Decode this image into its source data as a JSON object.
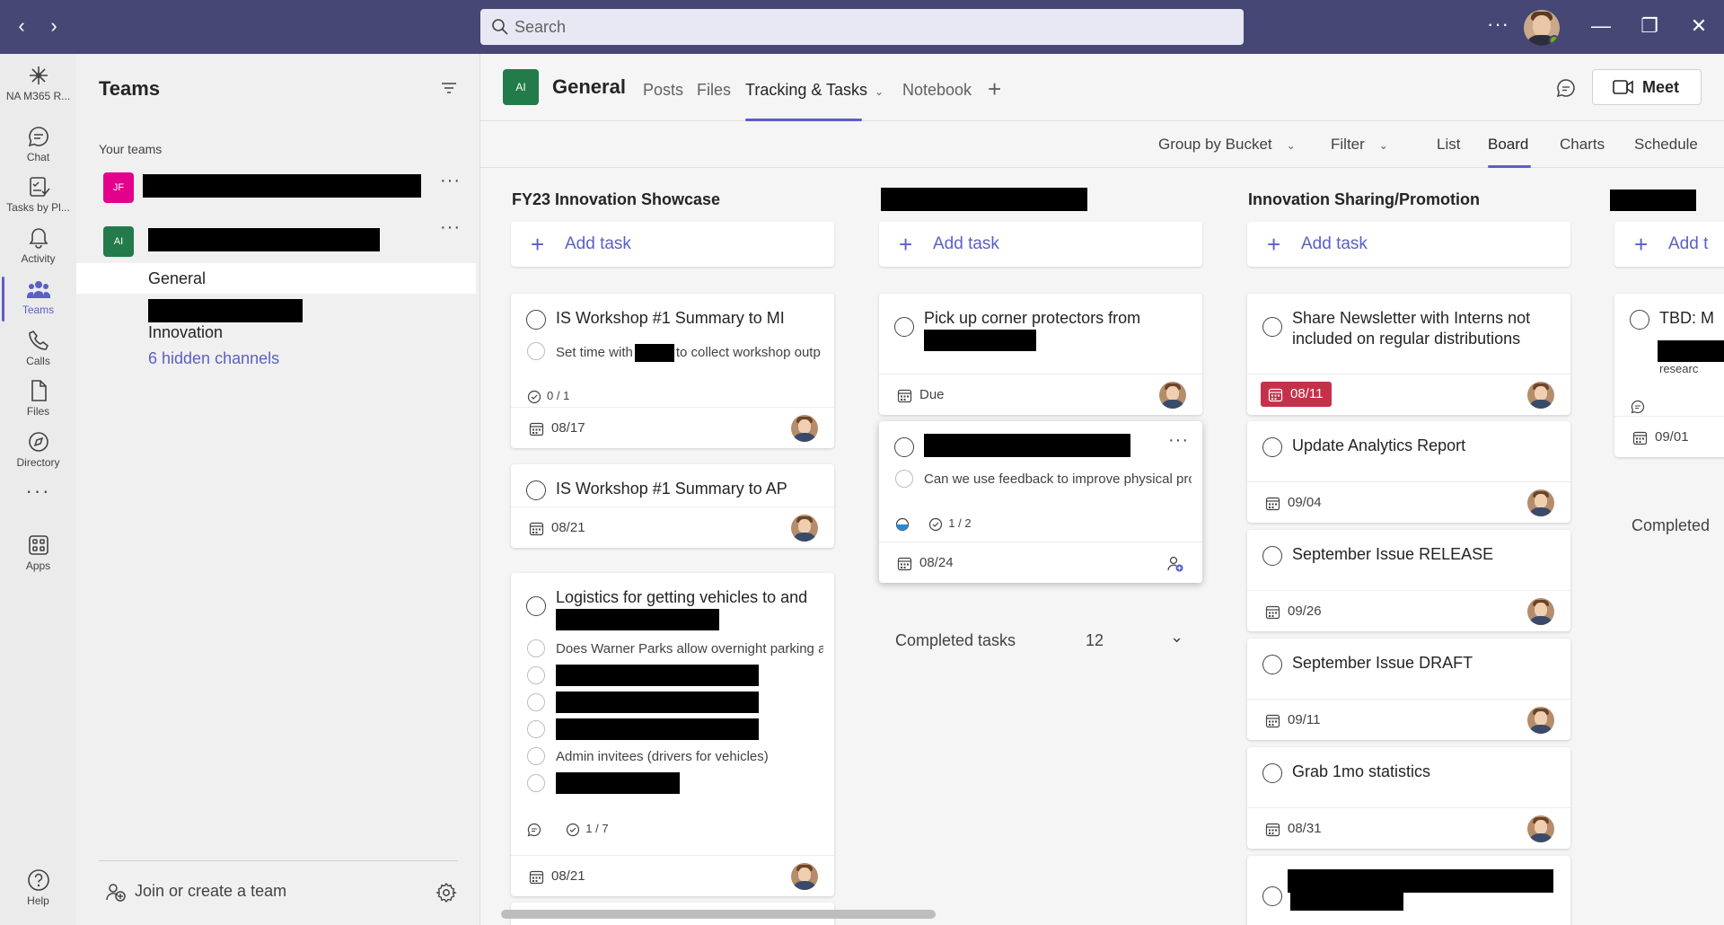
{
  "search": {
    "placeholder": "Search"
  },
  "rail": [
    {
      "label": "NA M365 R...",
      "icon": "org-icon"
    },
    {
      "label": "Chat",
      "icon": "chat-icon"
    },
    {
      "label": "Tasks by Pl...",
      "icon": "tasks-icon"
    },
    {
      "label": "Activity",
      "icon": "bell-icon"
    },
    {
      "label": "Teams",
      "icon": "teams-icon",
      "active": true
    },
    {
      "label": "Calls",
      "icon": "phone-icon"
    },
    {
      "label": "Files",
      "icon": "file-icon"
    },
    {
      "label": "Directory",
      "icon": "compass-icon"
    },
    {
      "label": "Apps",
      "icon": "apps-icon"
    },
    {
      "label": "Help",
      "icon": "help-icon"
    }
  ],
  "teams_panel": {
    "title": "Teams",
    "section": "Your teams",
    "teams": [
      {
        "initials": "JF",
        "color": "#e3008c"
      },
      {
        "initials": "AI",
        "color": "#237b4b"
      }
    ],
    "channels": {
      "general": "General",
      "innovation": "Innovation",
      "hidden": "6 hidden channels"
    },
    "join": "Join or create a team"
  },
  "channel": {
    "initials": "AI",
    "name": "General",
    "tabs": [
      "Posts",
      "Files",
      "Tracking & Tasks",
      "Notebook"
    ],
    "meet": "Meet"
  },
  "toolbar": {
    "group_by": "Group by Bucket",
    "filter": "Filter",
    "views": [
      "List",
      "Board",
      "Charts",
      "Schedule"
    ],
    "active_view": "Board"
  },
  "board": {
    "add_task": "Add task",
    "add_task_partial": "Add t",
    "columns": [
      {
        "title": "FY23 Innovation Showcase",
        "cards": [
          {
            "title": "IS Workshop #1 Summary to MI",
            "sub_before": "Set time with",
            "sub_after": "to collect workshop outp",
            "checklist": "0 / 1",
            "due": "08/17"
          },
          {
            "title": "IS Workshop #1 Summary to AP",
            "due": "08/21"
          },
          {
            "title": "Logistics for getting vehicles to and",
            "items": [
              "Does Warner Parks allow overnight parking a",
              "Admin invitees (drivers for vehicles)"
            ],
            "checklist": "1 / 7",
            "due": "08/21"
          }
        ]
      },
      {
        "title": "",
        "cards": [
          {
            "title": "Pick up corner protectors from",
            "due": "Due"
          },
          {
            "sub": "Can we use feedback to improve physical pro",
            "checklist": "1 / 2",
            "due": "08/24"
          }
        ],
        "completed_label": "Completed tasks",
        "completed_count": "12"
      },
      {
        "title": "Innovation Sharing/Promotion",
        "cards": [
          {
            "title": "Share Newsletter with Interns not included on regular distributions",
            "due": "08/11",
            "overdue": true
          },
          {
            "title": "Update Analytics Report",
            "due": "09/04"
          },
          {
            "title": "September Issue RELEASE",
            "due": "09/26"
          },
          {
            "title": "September Issue DRAFT",
            "due": "09/11"
          },
          {
            "title": "Grab 1mo statistics",
            "due": "08/31"
          }
        ]
      },
      {
        "title": "",
        "cards": [
          {
            "title": "TBD: M",
            "sub": "researc",
            "due": "09/01"
          }
        ],
        "completed_label": "Completed"
      }
    ]
  },
  "colors": {
    "titlebar": "#464775",
    "accent": "#5b5fc7",
    "overdue": "#c4314b"
  }
}
